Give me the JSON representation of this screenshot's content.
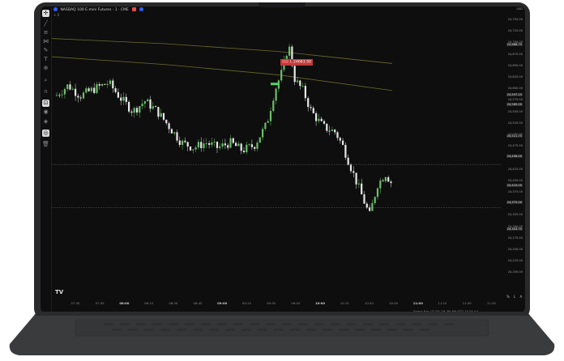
{
  "chart_header": {
    "symbol": "NASDAQ 100 E-mini Futures · 1 · CME",
    "sub": "+ 6"
  },
  "sell_label": "L 24663.50",
  "price_axis": {
    "currency": "USD",
    "labels": [
      "24,750.00",
      "24,725.00",
      "24,700.00",
      "24,675.00",
      "24,650.00",
      "24,625.00",
      "24,600.00",
      "24,575.00",
      "24,550.00",
      "24,525.00",
      "24,500.00",
      "24,475.00",
      "24,450.00",
      "24,425.00",
      "24,400.00",
      "24,375.00",
      "24,350.00",
      "24,325.00",
      "24,300.00",
      "24,275.00",
      "24,250.00",
      "24,225.00",
      "24,200.00"
    ],
    "boxed": [
      {
        "text": "24,688.75"
      },
      {
        "text": "24,597.25"
      },
      {
        "text": "24,585.00"
      },
      {
        "text": "24,521.75"
      },
      {
        "text": "24,458.00"
      },
      {
        "text": "24,410.00"
      },
      {
        "text": "24,375.00"
      },
      {
        "text": "24,303.75"
      }
    ]
  },
  "time_axis": {
    "labels": [
      {
        "text": "07:30",
        "bold": false
      },
      {
        "text": "07:45",
        "bold": false
      },
      {
        "text": "08:00",
        "bold": true
      },
      {
        "text": "08:15",
        "bold": false
      },
      {
        "text": "08:30",
        "bold": false
      },
      {
        "text": "08:45",
        "bold": false
      },
      {
        "text": "09:00",
        "bold": true
      },
      {
        "text": "09:15",
        "bold": false
      },
      {
        "text": "09:30",
        "bold": false
      },
      {
        "text": "09:45",
        "bold": false
      },
      {
        "text": "10:00",
        "bold": true
      },
      {
        "text": "10:15",
        "bold": false
      },
      {
        "text": "10:30",
        "bold": false
      },
      {
        "text": "10:45",
        "bold": false
      },
      {
        "text": "11:00",
        "bold": true
      },
      {
        "text": "11:15",
        "bold": false
      },
      {
        "text": "11:30",
        "bold": false
      },
      {
        "text": "11:45",
        "bold": false
      }
    ]
  },
  "bottom_bar": "Select Bar   1D  5D  1M  3M  6M  YTD  1Y  5Y  All",
  "scale_buttons": [
    "%",
    "L",
    "A"
  ],
  "tv_logo": "TV",
  "toolbar_icons": [
    "crosshair-icon",
    "trendline-icon",
    "fib-icon",
    "pattern-icon",
    "brush-icon",
    "text-icon",
    "measure-icon",
    "zoom-icon",
    "magnet-icon",
    "lock-icon",
    "eye-icon",
    "trash-icon"
  ],
  "colors": {
    "bull": "#6abf69",
    "bear": "#e8e8e8",
    "sell": "#c0393b",
    "envelope": "#6b6a2c"
  },
  "chart_data": {
    "type": "candlestick",
    "x_start": "07:20",
    "x_end": "11:50",
    "ylim": [
      24200,
      24760
    ],
    "upper_band": [
      [
        0,
        24700
      ],
      [
        140,
        24690
      ],
      [
        280,
        24675
      ],
      [
        420,
        24652
      ]
    ],
    "lower_band": [
      [
        0,
        24665
      ],
      [
        140,
        24650
      ],
      [
        280,
        24630
      ],
      [
        420,
        24600
      ]
    ],
    "dashed_levels": [
      24458,
      24375
    ]
  }
}
